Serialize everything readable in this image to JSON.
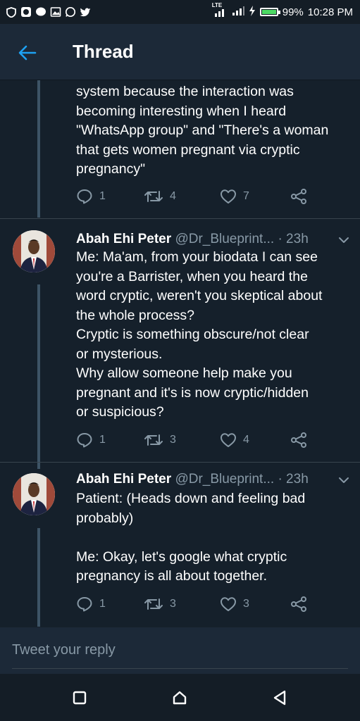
{
  "status_bar": {
    "network": "LTE",
    "battery_level": "99%",
    "time": "10:28 PM",
    "battery_fraction": 0.99
  },
  "header": {
    "title": "Thread",
    "back_icon": "arrow-left-icon"
  },
  "tweets": [
    {
      "text": "system because the interaction was\nbecoming interesting when I heard\n\"WhatsApp group\" and \"There's a woman\nthat gets women pregnant via cryptic\npregnancy\"",
      "replies": "1",
      "retweets": "4",
      "likes": "7"
    },
    {
      "author": "Abah Ehi Peter",
      "handle": "@Dr_Blueprint...",
      "time": "· 23h",
      "text": "Me: Ma'am, from your biodata I can see\nyou're a Barrister, when you heard the\nword cryptic, weren't you skeptical about\nthe whole process?\nCryptic is something obscure/not clear\nor mysterious.\nWhy allow someone help make you\npregnant and it's is now cryptic/hidden\nor suspicious?",
      "replies": "1",
      "retweets": "3",
      "likes": "4"
    },
    {
      "author": "Abah Ehi Peter",
      "handle": "@Dr_Blueprint...",
      "time": "· 23h",
      "text": "Patient: (Heads down and feeling bad\nprobably)\n\nMe: Okay, let's google what cryptic\npregnancy is all about together.",
      "replies": "1",
      "retweets": "3",
      "likes": "3"
    }
  ],
  "reply": {
    "placeholder": "Tweet your reply"
  },
  "colors": {
    "background": "#15202b",
    "header": "#1c2938",
    "accent": "#1da1f2",
    "secondary_text": "#8899a6"
  }
}
